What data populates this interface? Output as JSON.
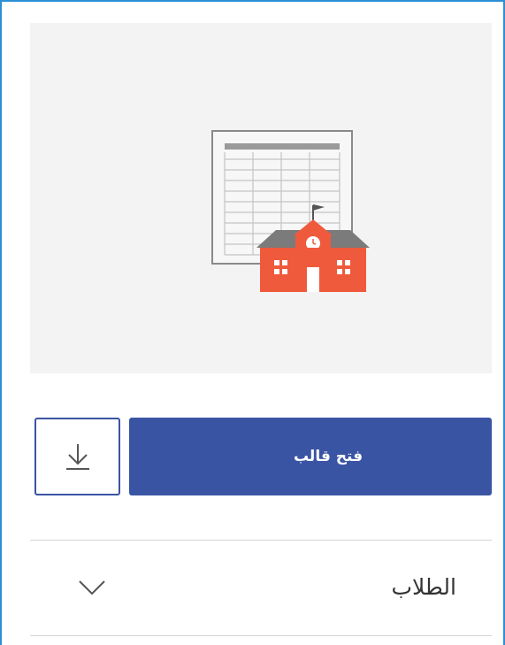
{
  "template_card": {
    "preview": {
      "icon": "class-schedule-school-icon",
      "colors": {
        "background": "#f3f3f3",
        "sheet": "#f4f4f4",
        "school": "#ef5a3c"
      }
    },
    "open_button_label": "فتح قالب",
    "download_icon": "download-icon",
    "section": {
      "label": "الطلاب",
      "expand_icon": "chevron-down-icon"
    },
    "colors": {
      "accent": "#3a54a4",
      "frame_border": "#2b8fd6"
    }
  }
}
